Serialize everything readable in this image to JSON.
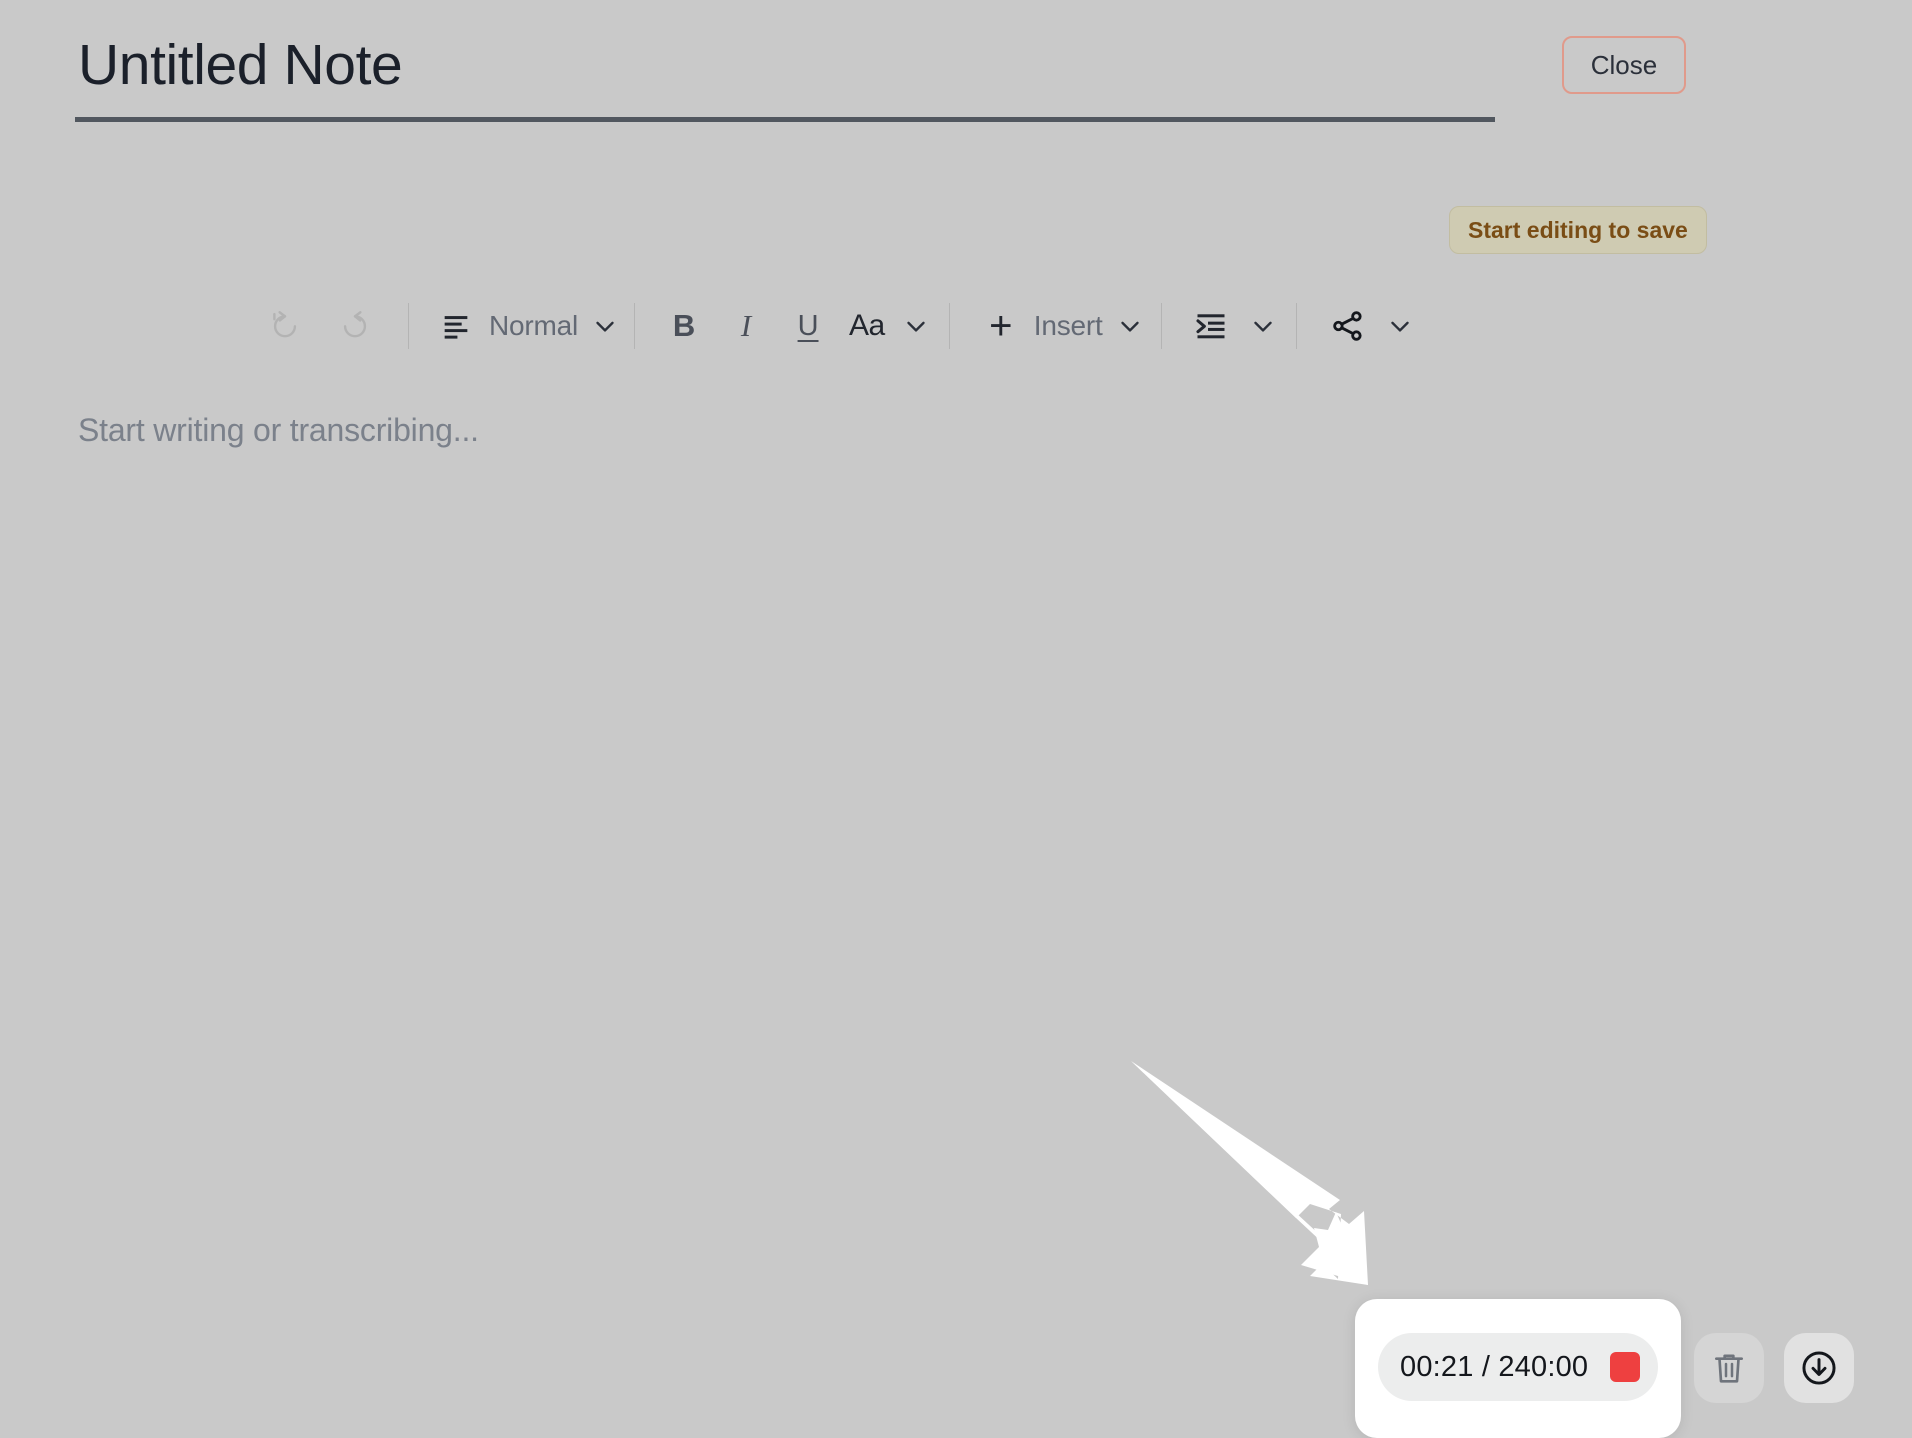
{
  "window": {
    "background_color": "#c9c9c9"
  },
  "header": {
    "title": "Untitled Note",
    "title_placeholder": "Untitled Note",
    "close_label": "Close",
    "close_border_color": "#e09a8b"
  },
  "save_status": {
    "label": "Start editing to save",
    "background_color": "#cfcbb2",
    "text_color": "#7a4d15"
  },
  "toolbar": {
    "undo": {
      "name": "undo",
      "disabled": true
    },
    "redo": {
      "name": "redo",
      "disabled": true
    },
    "paragraph_style": {
      "icon": "text-align-left-icon",
      "label": "Normal",
      "chevron": "chevron-down-icon"
    },
    "bold_label": "B",
    "italic_label": "I",
    "underline_label": "U",
    "font_label": "Aa",
    "font_chevron": "chevron-down-icon",
    "insert_plus": "+",
    "insert_label": "Insert",
    "insert_chevron": "chevron-down-icon",
    "indent_icon": "indent-increase-icon",
    "indent_chevron": "chevron-down-icon",
    "share_icon": "share-nodes-icon",
    "share_chevron": "chevron-down-icon"
  },
  "editor": {
    "placeholder": "Start writing or transcribing...",
    "content": ""
  },
  "annotation": {
    "type": "arrow",
    "color": "#ffffff",
    "points_to": "recording-timer-pill"
  },
  "recorder": {
    "elapsed": "00:21",
    "separator": "/",
    "total": "240:00",
    "time_display": "00:21 / 240:00",
    "stop_color": "#ee4040",
    "stop_icon": "stop-square-icon",
    "delete_icon": "trash-icon",
    "download_icon": "download-circle-icon"
  }
}
